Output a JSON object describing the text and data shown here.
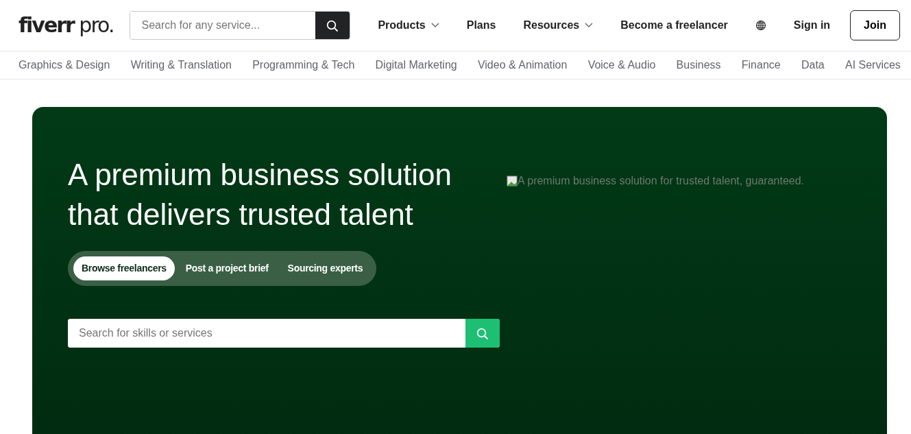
{
  "header": {
    "logo": {
      "word": "fiverr",
      "suffix": "pro."
    },
    "search": {
      "placeholder": "Search for any service..."
    },
    "nav": [
      {
        "label": "Products",
        "dropdown": true
      },
      {
        "label": "Plans",
        "dropdown": false
      },
      {
        "label": "Resources",
        "dropdown": true
      },
      {
        "label": "Become a freelancer",
        "dropdown": false
      }
    ],
    "sign_in": "Sign in",
    "join": "Join"
  },
  "categories": [
    "Graphics & Design",
    "Writing & Translation",
    "Programming & Tech",
    "Digital Marketing",
    "Video & Animation",
    "Voice & Audio",
    "Business",
    "Finance",
    "Data",
    "AI Services"
  ],
  "hero": {
    "title": "A premium business solution that delivers trusted talent",
    "image_alt": "A premium business solution for trusted talent, guaranteed.",
    "tabs": [
      {
        "label": "Browse freelancers",
        "selected": true
      },
      {
        "label": "Post a project brief",
        "selected": false
      },
      {
        "label": "Sourcing experts",
        "selected": false
      }
    ],
    "search": {
      "placeholder": "Search for skills or services"
    }
  }
}
